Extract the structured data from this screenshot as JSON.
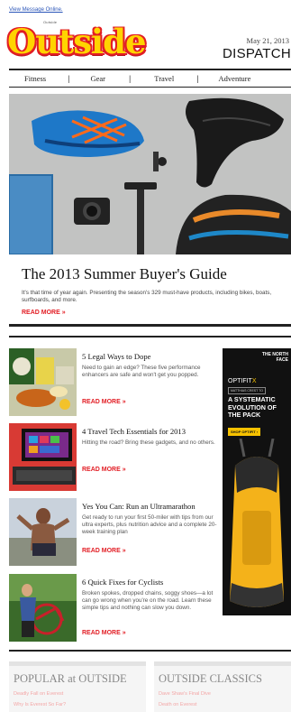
{
  "header": {
    "view_online": "View Message Online.",
    "logo_small": "Outside",
    "logo": "Outside",
    "date": "May 21, 2013",
    "dispatch": "DISPATCH"
  },
  "nav": {
    "items": [
      "Fitness",
      "Gear",
      "Travel",
      "Adventure"
    ],
    "separator": "|"
  },
  "feature": {
    "title": "The 2013 Summer Buyer's Guide",
    "description": "It's that time of year again. Presenting the season's 329 must-have products, including bikes, boats, surfboards, and more.",
    "read_more": "READ MORE »"
  },
  "articles": [
    {
      "title": "5 Legal Ways to Dope",
      "description": "Need to gain an edge? These five performance enhancers are safe and won't get you popped.",
      "read_more": "READ MORE »"
    },
    {
      "title": "4 Travel Tech Essentials for 2013",
      "description": "Hitting the road? Bring these gadgets, and no others.",
      "read_more": "READ MORE »"
    },
    {
      "title": "Yes You Can: Run an Ultramarathon",
      "description": "Get ready to run your first 50-miler with tips from our ultra experts, plus nutrition advice and a complete 20-week training plan",
      "read_more": "READ MORE »"
    },
    {
      "title": "6 Quick Fixes for Cyclists",
      "description": "Broken spokes, dropped chains, soggy shoes—a lot can go wrong when you're on the road. Learn these simple tips and nothing can slow you down.",
      "read_more": "READ MORE »"
    }
  ],
  "ad": {
    "brand": "THE NORTH FACE",
    "product_prefix": "OPTIFIT",
    "product_suffix": "X",
    "athlete": "MATTHIAS CREST TO",
    "headline": "A SYSTEMATIC EVOLUTION OF THE PACK",
    "cta": "SHOP OPTIFIT ›"
  },
  "bottom": {
    "popular_title": "POPULAR at OUTSIDE",
    "popular_links": [
      "Deadly Fall on Everest",
      "Why Is Everest So Far?"
    ],
    "classics_title": "OUTSIDE CLASSICS",
    "classics_links": [
      "Dave Shaw's Final Dive",
      "Death on Everest"
    ]
  },
  "colors": {
    "accent_red": "#e21d24",
    "logo_yellow": "#ffd400",
    "link_blue": "#2a55b8",
    "ad_yellow": "#f7c200"
  }
}
